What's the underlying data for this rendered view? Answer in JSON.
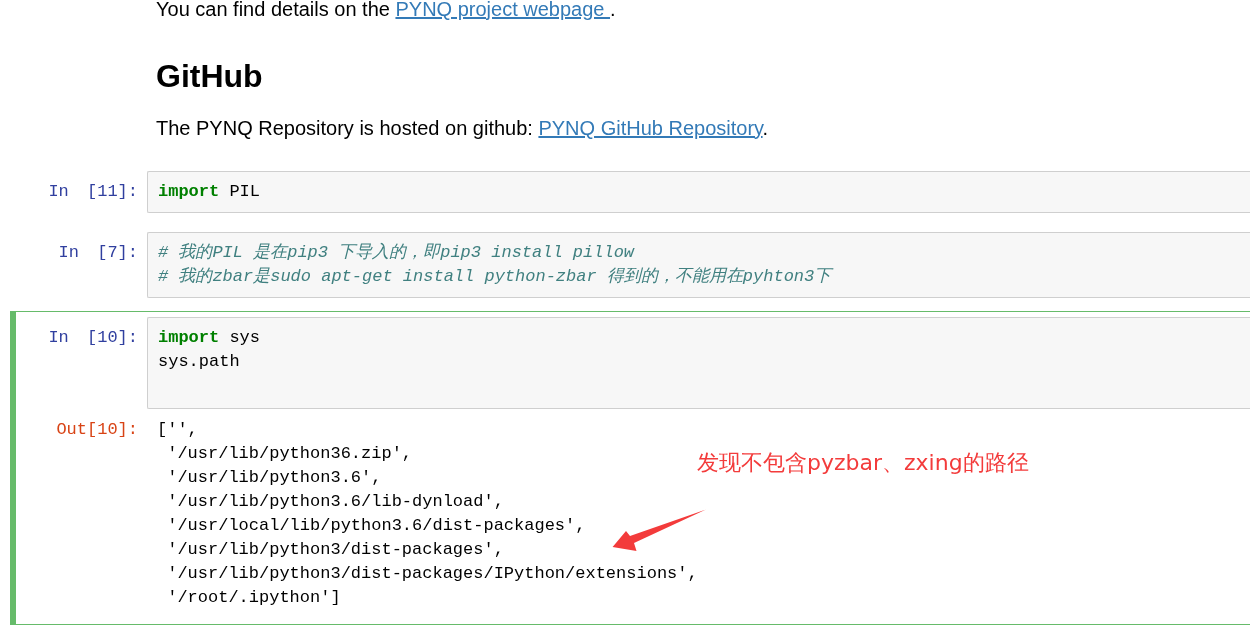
{
  "markdown": {
    "intro": {
      "before": "You can find details on the ",
      "link": "PYNQ project webpage ",
      "after": "."
    },
    "heading": "GitHub",
    "paragraph": {
      "before": "The PYNQ Repository is hosted on github: ",
      "link": "PYNQ GitHub Repository",
      "after": "."
    }
  },
  "cells": [
    {
      "prompt": "In [11]:",
      "selected": false,
      "input": [
        {
          "kind": "code",
          "text": "**import** PIL"
        }
      ]
    },
    {
      "prompt": "In [7]:",
      "selected": false,
      "input": [
        {
          "kind": "comment",
          "text": "# 我的PIL 是在pip3 下导入的，即pip3 install pillow"
        },
        {
          "kind": "comment",
          "text": "# 我的zbar是sudo apt-get install python-zbar 得到的，不能用在pyhton3下"
        }
      ]
    },
    {
      "prompt": "In [10]:",
      "selected": true,
      "input": [
        {
          "kind": "code",
          "text": "**import** sys"
        },
        {
          "kind": "code",
          "text": "sys.path"
        }
      ],
      "output": {
        "prompt": "Out[10]:",
        "lines": [
          "['',",
          " '/usr/lib/python36.zip',",
          " '/usr/lib/python3.6',",
          " '/usr/lib/python3.6/lib-dynload',",
          " '/usr/local/lib/python3.6/dist-packages',",
          " '/usr/lib/python3/dist-packages',",
          " '/usr/lib/python3/dist-packages/IPython/extensions',",
          " '/root/.ipython']"
        ]
      }
    }
  ],
  "annotation": {
    "text": "发现不包含pyzbar、zxing的路径"
  }
}
